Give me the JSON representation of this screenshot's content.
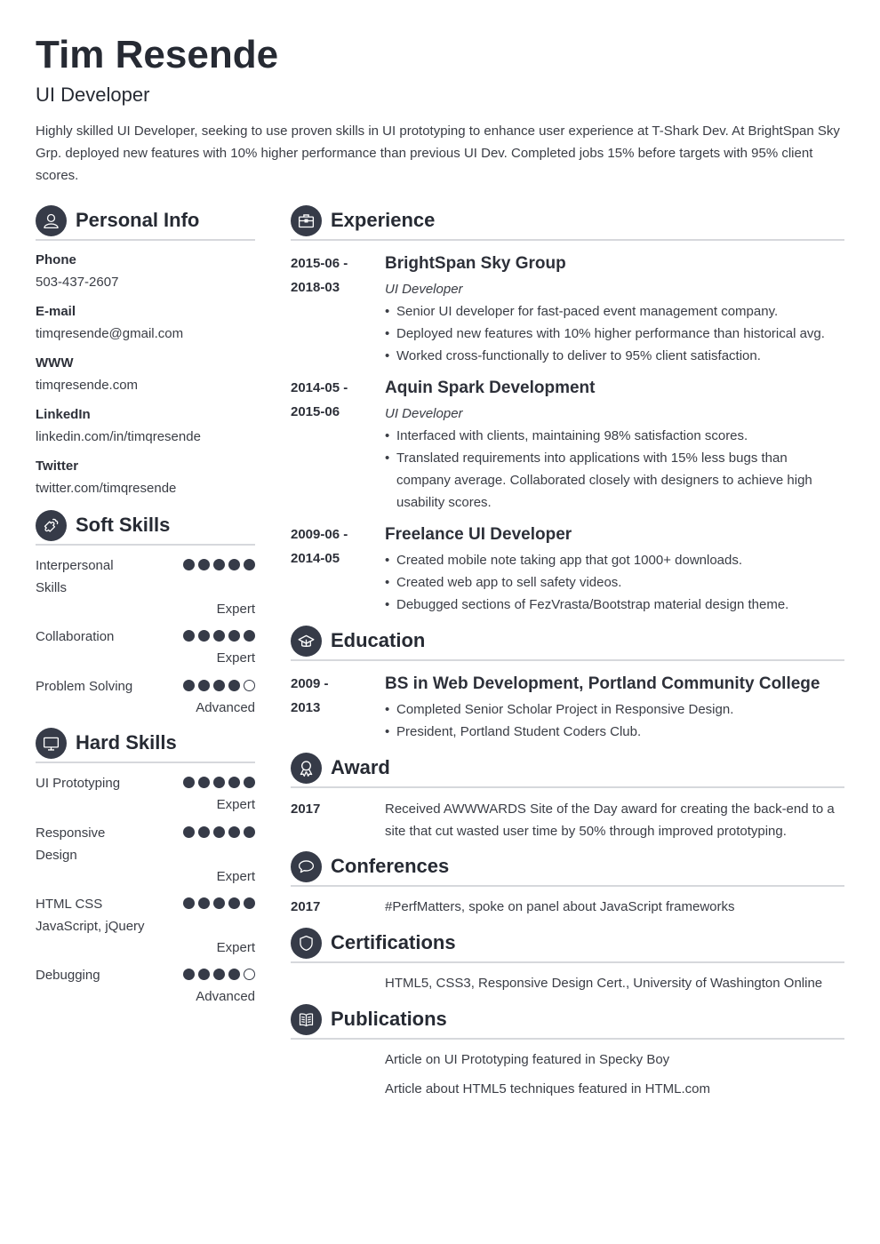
{
  "header": {
    "name": "Tim Resende",
    "job_title": "UI Developer",
    "summary": "Highly skilled UI Developer, seeking to use proven skills in UI prototyping to enhance user experience at T-Shark Dev. At BrightSpan Sky Grp. deployed new features with 10% higher performance than previous UI Dev. Completed jobs 15% before targets with 95% client scores."
  },
  "colors": {
    "accent": "#363b48",
    "text": "#2d3039",
    "divider": "#d6d8dc"
  },
  "personal_info": {
    "title": "Personal Info",
    "icon": "user-icon",
    "items": [
      {
        "label": "Phone",
        "value": "503-437-2607"
      },
      {
        "label": "E-mail",
        "value": "timqresende@gmail.com"
      },
      {
        "label": "WWW",
        "value": "timqresende.com"
      },
      {
        "label": "LinkedIn",
        "value": "linkedin.com/in/timqresende"
      },
      {
        "label": "Twitter",
        "value": "twitter.com/timqresende"
      }
    ]
  },
  "soft_skills": {
    "title": "Soft Skills",
    "icon": "puzzle-icon",
    "items": [
      {
        "name": "Interpersonal Skills",
        "rating": 5,
        "max": 5,
        "level": "Expert"
      },
      {
        "name": "Collaboration",
        "rating": 5,
        "max": 5,
        "level": "Expert"
      },
      {
        "name": "Problem Solving",
        "rating": 4,
        "max": 5,
        "level": "Advanced"
      }
    ]
  },
  "hard_skills": {
    "title": "Hard Skills",
    "icon": "monitor-icon",
    "items": [
      {
        "name": "UI Prototyping",
        "rating": 5,
        "max": 5,
        "level": "Expert"
      },
      {
        "name": "Responsive Design",
        "rating": 5,
        "max": 5,
        "level": "Expert"
      },
      {
        "name": "HTML CSS JavaScript, jQuery",
        "rating": 5,
        "max": 5,
        "level": "Expert"
      },
      {
        "name": "Debugging",
        "rating": 4,
        "max": 5,
        "level": "Advanced"
      }
    ]
  },
  "experience": {
    "title": "Experience",
    "icon": "briefcase-icon",
    "items": [
      {
        "date_start": "2015-06 -",
        "date_end": "2018-03",
        "company": "BrightSpan Sky Group",
        "role": "UI Developer",
        "bullets": [
          "Senior UI developer for fast-paced event management company.",
          "Deployed new features with 10% higher performance than historical avg.",
          "Worked cross-functionally to deliver to 95% client satisfaction."
        ]
      },
      {
        "date_start": "2014-05 -",
        "date_end": "2015-06",
        "company": "Aquin Spark Development",
        "role": "UI Developer",
        "bullets": [
          "Interfaced with clients, maintaining 98% satisfaction scores.",
          "Translated requirements into applications with 15% less bugs than company average. Collaborated closely with designers to achieve high usability scores."
        ]
      },
      {
        "date_start": "2009-06 -",
        "date_end": "2014-05",
        "company": "Freelance UI Developer",
        "bullets": [
          "Created mobile note taking app that got 1000+ downloads.",
          "Created web app to sell safety videos.",
          "Debugged sections of FezVrasta/Bootstrap material design theme."
        ]
      }
    ]
  },
  "education": {
    "title": "Education",
    "icon": "graduation-cap-icon",
    "items": [
      {
        "date_start": "2009 -",
        "date_end": "2013",
        "degree": "BS in Web Development, Portland Community College",
        "bullets": [
          "Completed Senior Scholar Project in Responsive Design.",
          "President, Portland Student Coders Club."
        ]
      }
    ]
  },
  "award": {
    "title": "Award",
    "icon": "award-ribbon-icon",
    "items": [
      {
        "date": "2017",
        "text": "Received AWWWARDS Site of the Day award for creating the back-end to a site that cut wasted user time by 50% through improved prototyping."
      }
    ]
  },
  "conferences": {
    "title": "Conferences",
    "icon": "speech-bubble-icon",
    "items": [
      {
        "date": "2017",
        "text": "#PerfMatters, spoke on panel about JavaScript frameworks"
      }
    ]
  },
  "certifications": {
    "title": "Certifications",
    "icon": "shield-icon",
    "items": [
      {
        "text": "HTML5, CSS3, Responsive Design Cert., University of Washington Online"
      }
    ]
  },
  "publications": {
    "title": "Publications",
    "icon": "book-icon",
    "items": [
      {
        "text": "Article on UI Prototyping featured in Specky Boy"
      },
      {
        "text": "Article about HTML5 techniques featured in HTML.com"
      }
    ]
  }
}
